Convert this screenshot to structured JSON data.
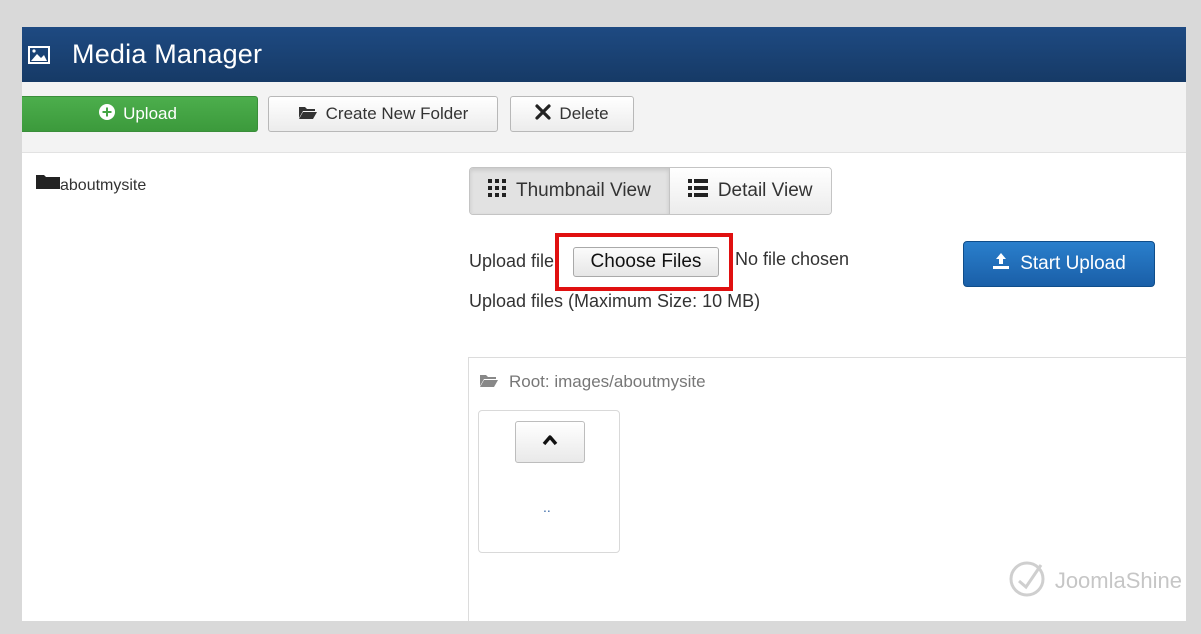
{
  "header": {
    "title": "Media Manager",
    "icon": "image-icon"
  },
  "toolbar": {
    "upload_label": "Upload",
    "create_folder_label": "Create New Folder",
    "delete_label": "Delete"
  },
  "sidebar": {
    "items": [
      {
        "label": "aboutmysite",
        "icon": "folder-icon"
      }
    ]
  },
  "views": {
    "thumbnail_label": "Thumbnail View",
    "detail_label": "Detail View",
    "active": "thumbnail"
  },
  "upload": {
    "label": "Upload file",
    "choose_label": "Choose Files",
    "no_file_text": "No file chosen",
    "max_size_text": "Upload files (Maximum Size: 10 MB)",
    "start_label": "Start Upload"
  },
  "browser": {
    "root_text": "Root: images/aboutmysite",
    "parent_link": ".."
  },
  "watermark": {
    "text": "JoomlaShine"
  },
  "colors": {
    "header_bg": "#1a3f6f",
    "upload_green": "#44a544",
    "start_blue": "#1f6cb8",
    "highlight_red": "#e01010"
  }
}
